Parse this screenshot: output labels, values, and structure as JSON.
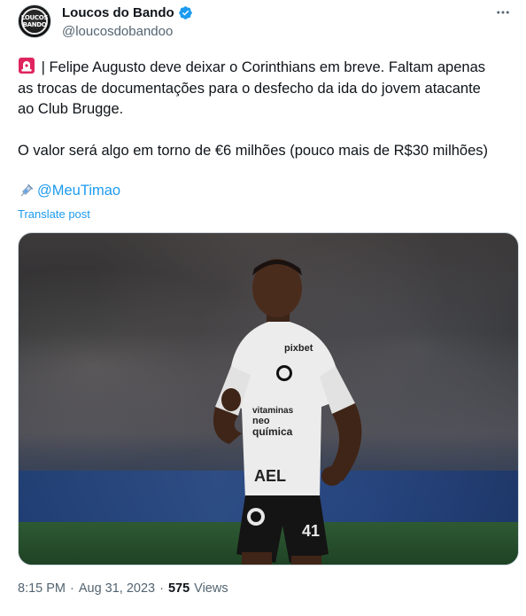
{
  "author": {
    "display_name": "Loucos do Bando",
    "handle": "@loucosdobandoo",
    "avatar_text_line1": "LOUCOS",
    "avatar_text_line2": "BANDO",
    "verified": true
  },
  "tweet": {
    "line1": "| Felipe Augusto deve deixar o Corinthians em breve. Faltam apenas",
    "line2": "as trocas de documentações para o desfecho da ida do jovem atacante",
    "line3": "ao Club Brugge.",
    "line4": "O valor será algo em torno de €6 milhões (pouco mais de R$30 milhões)",
    "mention": "@MeuTimao",
    "translate_label": "Translate post"
  },
  "media": {
    "jersey_sponsor_top": "pixbet",
    "jersey_sponsor_mid1": "vitaminas",
    "jersey_sponsor_mid2": "neo",
    "jersey_sponsor_mid3": "química",
    "jersey_sponsor_low": "AEL",
    "shorts_number": "41"
  },
  "meta": {
    "time": "8:15 PM",
    "separator1": "·",
    "date": "Aug 31, 2023",
    "separator2": "·",
    "views_count": "575",
    "views_label": "Views"
  },
  "colors": {
    "link": "#1d9bf0",
    "text": "#0f1419",
    "secondary": "#536471",
    "verified": "#1d9bf0"
  },
  "icons": [
    "verified-badge-icon",
    "more-icon",
    "siren-icon",
    "syringe-icon"
  ]
}
